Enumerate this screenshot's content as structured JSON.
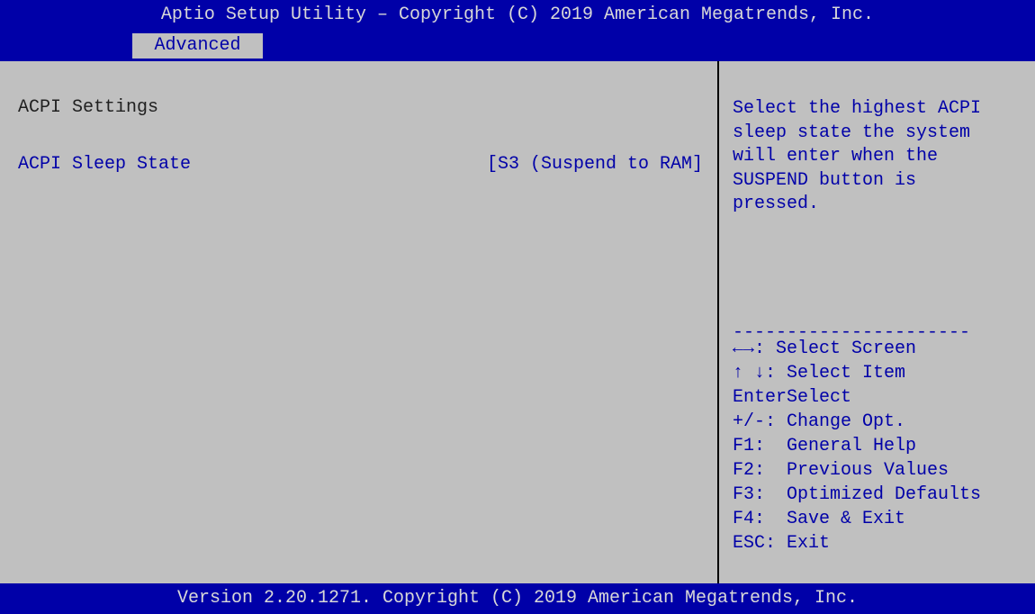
{
  "header": {
    "title": "Aptio Setup Utility – Copyright (C) 2019 American Megatrends, Inc."
  },
  "tabs": {
    "active": "Advanced"
  },
  "main": {
    "section_title": "ACPI Settings",
    "settings": [
      {
        "label": "ACPI Sleep State",
        "value": "[S3 (Suspend to RAM]"
      }
    ]
  },
  "help": {
    "description": "Select the highest ACPI\nsleep state the system\nwill enter when the\nSUSPEND button is\npressed.",
    "separator": "----------------------",
    "keys": [
      "←→: Select Screen",
      "↑ ↓: Select Item",
      "EnterSelect",
      "+/-: Change Opt.",
      "F1:  General Help",
      "F2:  Previous Values",
      "F3:  Optimized Defaults",
      "F4:  Save & Exit",
      "ESC: Exit"
    ]
  },
  "footer": {
    "version": "Version 2.20.1271. Copyright (C) 2019 American Megatrends, Inc."
  },
  "colors": {
    "bar_blue": "#0000a8",
    "panel_gray": "#c0c0c0",
    "bar_text": "#d8d8d8"
  }
}
